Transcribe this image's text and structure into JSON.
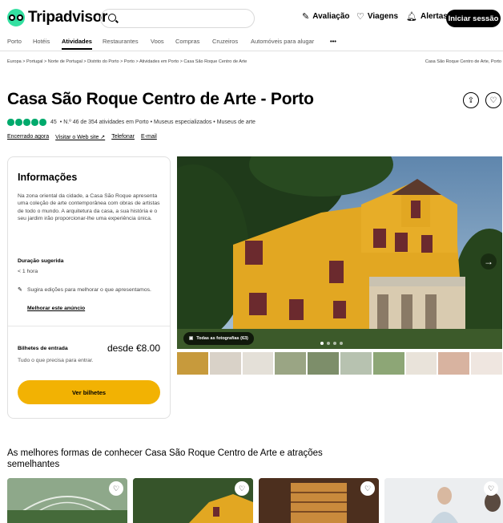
{
  "header": {
    "logo_text": "Tripadvisor",
    "search_placeholder": "",
    "links": [
      {
        "label": "Avaliação",
        "icon": "pencil-icon"
      },
      {
        "label": "Viagens",
        "icon": "heart-icon"
      },
      {
        "label": "Alertas",
        "icon": "bell-icon"
      }
    ],
    "signin_label": "Iniciar sessão"
  },
  "nav": {
    "items": [
      "Porto",
      "Hotéis",
      "Atividades",
      "Restaurantes",
      "Voos",
      "Compras",
      "Cruzeiros",
      "Automóveis para alugar",
      "•••"
    ],
    "active": "Atividades"
  },
  "breadcrumb": {
    "path": "Europa > Portugal > Norte de Portugal > Distrito do Porto > Porto > Atividades em Porto > Casa São Roque Centro de Arte",
    "right": "Casa São Roque Centro de Arte, Porto"
  },
  "attraction": {
    "title": "Casa São Roque Centro de Arte - Porto",
    "review_count": "45",
    "rank_text": "• N.º 46 de 354 atividades em Porto • Museus especializados • Museus de arte",
    "rating_bubbles": 5,
    "status": "Encerrado agora",
    "website": "Visitar o Web site ↗",
    "phone": "Telefonar",
    "email": "E-mail"
  },
  "info_card": {
    "heading": "Informações",
    "description": "Na zona oriental da cidade, a Casa São Roque apresenta uma coleção de arte contemporânea com obras de artistas de todo o mundo. A arquitetura da casa, a sua história e o seu jardim irão proporcionar-lhe uma experiência única.",
    "duration_label": "Duração sugerida",
    "duration_value": "< 1 hora",
    "suggest_text": "Sugira edições para melhorar o que apresentamos.",
    "improve_link": "Melhorar este anúncio",
    "tickets_label": "Bilhetes de entrada",
    "tickets_price": "desde €8.00",
    "tickets_sub": "Tudo o que precisa para entrar.",
    "tickets_button": "Ver bilhetes"
  },
  "gallery": {
    "all_photos_label": "Todas as fotografias (63)",
    "dots": 4,
    "active_dot": 0
  },
  "section": {
    "title": "As melhores formas de conhecer Casa São Roque Centro de Arte e atrações semelhantes"
  },
  "colors": {
    "brand_green": "#34e0a1",
    "rating_green": "#00aa6c",
    "ticket_button": "#f2b203",
    "signin_bg": "#000000"
  }
}
